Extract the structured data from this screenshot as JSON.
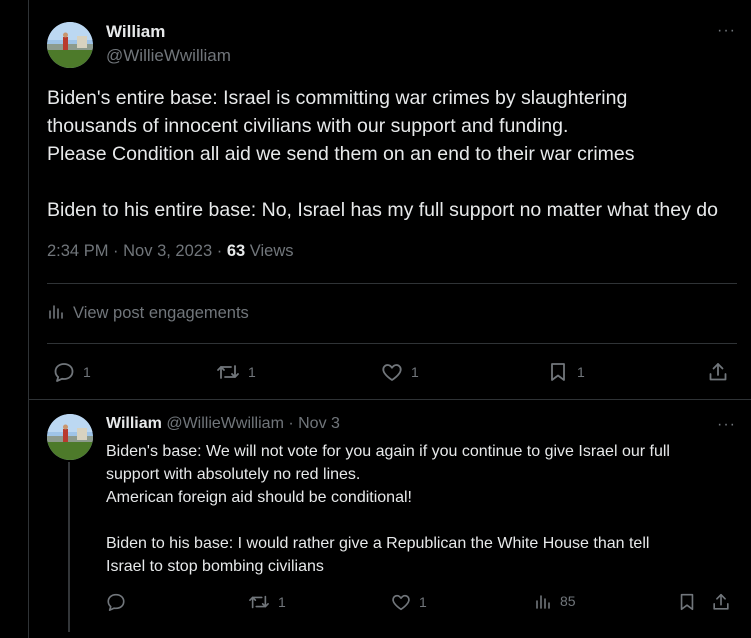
{
  "main_post": {
    "author_name": "William",
    "author_handle": "@WillieWwilliam",
    "more_label": "···",
    "text_lines": [
      "Biden's entire base:  Israel is committing war crimes by slaughtering",
      "thousands of innocent civilians with our support and funding.",
      "Please Condition all aid we send them on an end to their war crimes",
      "",
      "Biden to his entire base: No, Israel has my full support no matter what they do"
    ],
    "time": "2:34 PM",
    "date": "Nov 3, 2023",
    "views_count": "63",
    "views_label": "Views",
    "engagements_label": "View post engagements",
    "actions": {
      "reply_count": "1",
      "repost_count": "1",
      "like_count": "1",
      "bookmark_count": "1"
    }
  },
  "reply_post": {
    "author_name": "William",
    "author_handle": "@WillieWwilliam",
    "date": "Nov 3",
    "more_label": "···",
    "text_lines": [
      "Biden's base: We will not vote for you again if you continue to give Israel our full",
      "support with absolutely no red lines.",
      "American foreign aid should be conditional!",
      "",
      "Biden to his base: I would rather give a Republican the White House than tell",
      "Israel to stop bombing civilians"
    ],
    "actions": {
      "repost_count": "1",
      "like_count": "1",
      "views_count": "85"
    }
  },
  "icons": {
    "reply": "reply-icon",
    "repost": "repost-icon",
    "like": "heart-icon",
    "bookmark": "bookmark-icon",
    "share": "share-icon",
    "views": "views-chart-icon",
    "more": "more-dots-icon"
  },
  "colors": {
    "background": "#000000",
    "text": "#e7e9ea",
    "secondary": "#71767b",
    "divider": "#2f3336"
  }
}
